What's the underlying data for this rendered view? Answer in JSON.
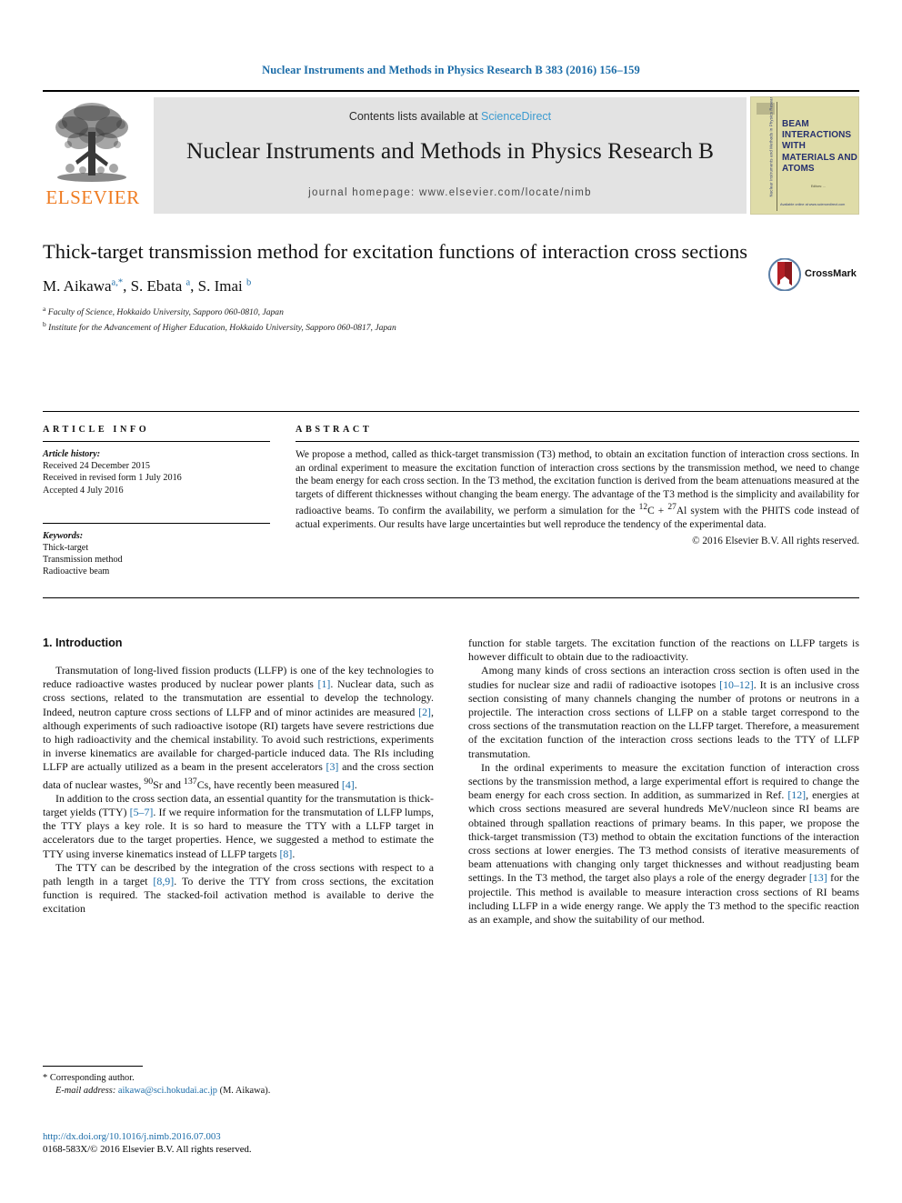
{
  "running_head": "Nuclear Instruments and Methods in Physics Research B 383 (2016) 156–159",
  "masthead": {
    "publisher_wordmark": "ELSEVIER",
    "contents_prefix": "Contents lists available at ",
    "contents_link": "ScienceDirect",
    "journal_title": "Nuclear Instruments and Methods in Physics Research B",
    "homepage_line": "journal homepage: www.elsevier.com/locate/nimb",
    "cover": {
      "title_lines": "BEAM INTERACTIONS WITH MATERIALS AND ATOMS",
      "spine_text": "Nuclear Instruments and Methods in Physics Research B",
      "foot_text": "Editors: ... ",
      "bottom_text": "Available online at www.sciencedirect.com"
    },
    "colors": {
      "link": "#3c9bd0",
      "wordmark": "#ef7c22",
      "banner_bg": "#e3e3e3",
      "cover_bg": "#dfdca8",
      "cover_text": "#26306e"
    }
  },
  "article": {
    "title": "Thick-target transmission method for excitation functions of interaction cross sections",
    "crossmark_label": "CrossMark",
    "authors_html": "M. Aikawa<sup>a,*</sup>, S. Ebata <sup>a</sup>, S. Imai <sup>b</sup>",
    "affiliation_a": "Faculty of Science, Hokkaido University, Sapporo 060-0810, Japan",
    "affiliation_b": "Institute for the Advancement of Higher Education, Hokkaido University, Sapporo 060-0817, Japan"
  },
  "info": {
    "heading": "ARTICLE INFO",
    "history_label": "Article history:",
    "history": [
      "Received 24 December 2015",
      "Received in revised form 1 July 2016",
      "Accepted 4 July 2016"
    ],
    "keywords_label": "Keywords:",
    "keywords": [
      "Thick-target",
      "Transmission method",
      "Radioactive beam"
    ]
  },
  "abstract": {
    "heading": "ABSTRACT",
    "text_html": "We propose a method, called as thick-target transmission (T3) method, to obtain an excitation function of interaction cross sections. In an ordinal experiment to measure the excitation function of interaction cross sections by the transmission method, we need to change the beam energy for each cross section. In the T3 method, the excitation function is derived from the beam attenuations measured at the targets of different thicknesses without changing the beam energy. The advantage of the T3 method is the simplicity and availability for radioactive beams. To confirm the availability, we perform a simulation for the <sup>12</sup>C&nbsp;+&nbsp;<sup>27</sup>Al system with the PHITS code instead of actual experiments. Our results have large uncertainties but well reproduce the tendency of the experimental data.",
    "copyright": "© 2016 Elsevier B.V. All rights reserved."
  },
  "section": {
    "heading": "1. Introduction"
  },
  "left_column_paragraphs": [
    "Transmutation of long-lived fission products (LLFP) is one of the key technologies to reduce radioactive wastes produced by nuclear power plants <a class=\"ref\" href=\"#\">[1]</a>. Nuclear data, such as cross sections, related to the transmutation are essential to develop the technology. Indeed, neutron capture cross sections of LLFP and of minor actinides are measured <a class=\"ref\" href=\"#\">[2]</a>, although experiments of such radioactive isotope (RI) targets have severe restrictions due to high radioactivity and the chemical instability. To avoid such restrictions, experiments in inverse kinematics are available for charged-particle induced data. The RIs including LLFP are actually utilized as a beam in the present accelerators <a class=\"ref\" href=\"#\">[3]</a> and the cross section data of nuclear wastes, <sup>90</sup>Sr and <sup>137</sup>Cs, have recently been measured <a class=\"ref\" href=\"#\">[4]</a>.",
    "In addition to the cross section data, an essential quantity for the transmutation is thick-target yields (TTY) <a class=\"ref\" href=\"#\">[5–7]</a>. If we require information for the transmutation of LLFP lumps, the TTY plays a key role. It is so hard to measure the TTY with a LLFP target in accelerators due to the target properties. Hence, we suggested a method to estimate the TTY using inverse kinematics instead of LLFP targets <a class=\"ref\" href=\"#\">[8]</a>.",
    "The TTY can be described by the integration of the cross sections with respect to a path length in a target <a class=\"ref\" href=\"#\">[8,9]</a>. To derive the TTY from cross sections, the excitation function is required. The stacked-foil activation method is available to derive the excitation"
  ],
  "right_column_paragraphs": [
    "function for stable targets. The excitation function of the reactions on LLFP targets is however difficult to obtain due to the radioactivity.",
    "Among many kinds of cross sections an interaction cross section is often used in the studies for nuclear size and radii of radioactive isotopes <a class=\"ref\" href=\"#\">[10–12]</a>. It is an inclusive cross section consisting of many channels changing the number of protons or neutrons in a projectile. The interaction cross sections of LLFP on a stable target correspond to the cross sections of the transmutation reaction on the LLFP target. Therefore, a measurement of the excitation function of the interaction cross sections leads to the TTY of LLFP transmutation.",
    "In the ordinal experiments to measure the excitation function of interaction cross sections by the transmission method, a large experimental effort is required to change the beam energy for each cross section. In addition, as summarized in Ref. <a class=\"ref\" href=\"#\">[12]</a>, energies at which cross sections measured are several hundreds MeV/nucleon since RI beams are obtained through spallation reactions of primary beams. In this paper, we propose the thick-target transmission (T3) method to obtain the excitation functions of the interaction cross sections at lower energies. The T3 method consists of iterative measurements of beam attenuations with changing only target thicknesses and without readjusting beam settings. In the T3 method, the target also plays a role of the energy degrader <a class=\"ref\" href=\"#\">[13]</a> for the projectile. This method is available to measure interaction cross sections of RI beams including LLFP in a wide energy range. We apply the T3 method to the specific reaction as an example, and show the suitability of our method."
  ],
  "footnotes": {
    "corresponding": "Corresponding author.",
    "email_label": "E-mail address:",
    "email": "aikawa@sci.hokudai.ac.jp",
    "email_suffix": "(M. Aikawa).",
    "doi": "http://dx.doi.org/10.1016/j.nimb.2016.07.003",
    "issn_line": "0168-583X/© 2016 Elsevier B.V. All rights reserved."
  }
}
